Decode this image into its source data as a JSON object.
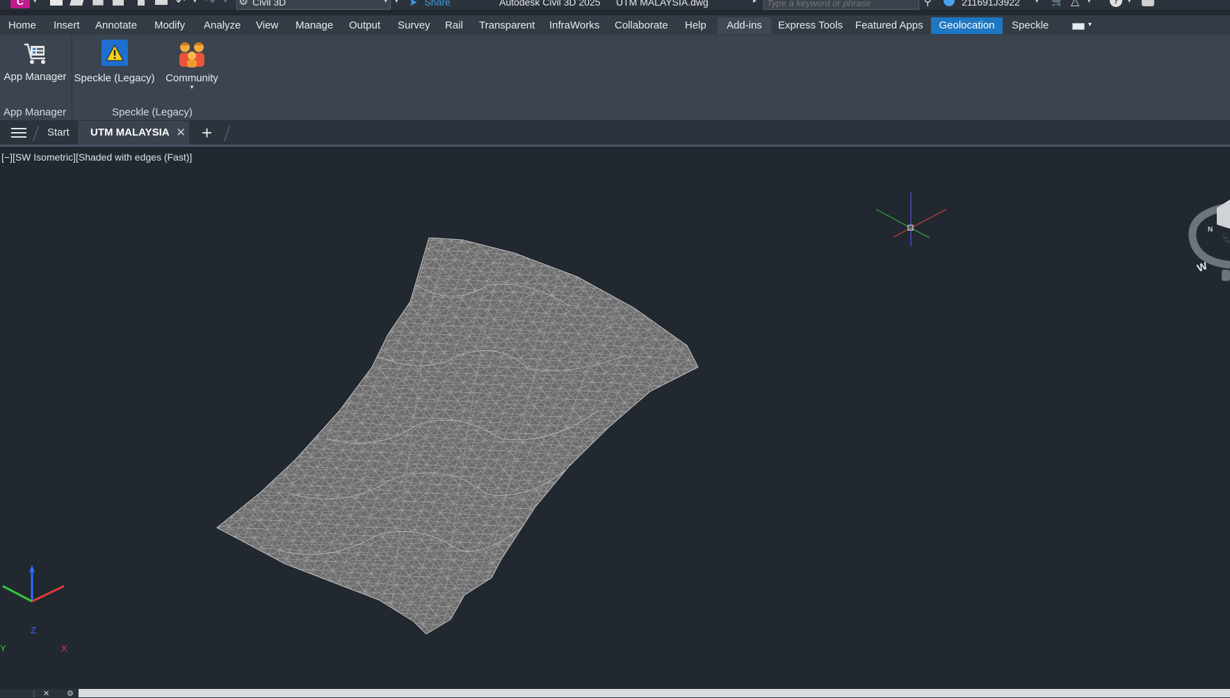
{
  "quick_access": {
    "workspace": "Civil 3D",
    "share_label": "Share"
  },
  "title_bar": {
    "app_title": "Autodesk Civil 3D 2025",
    "file_name": "UTM MALAYSIA.dwg",
    "search_placeholder": "Type a keyword or phrase",
    "user_name": "211691J3922"
  },
  "ribbon": {
    "tabs": [
      "Home",
      "Insert",
      "Annotate",
      "Modify",
      "Analyze",
      "View",
      "Manage",
      "Output",
      "Survey",
      "Rail",
      "Transparent",
      "InfraWorks",
      "Collaborate",
      "Help",
      "Add-ins",
      "Express Tools",
      "Featured Apps",
      "Geolocation",
      "Speckle"
    ],
    "active_tab": "Add-ins",
    "highlight_tab": "Geolocation",
    "buttons": {
      "app_manager": "App Manager",
      "speckle_legacy": "Speckle (Legacy)",
      "community": "Community"
    },
    "groups": {
      "app_manager": "App Manager",
      "speckle_legacy": "Speckle (Legacy)"
    }
  },
  "file_tabs": {
    "start": "Start",
    "active": "UTM MALAYSIA"
  },
  "viewport": {
    "label": "[−][SW Isometric][Shaded with edges (Fast)]",
    "ucs": {
      "x": "X",
      "y": "Y",
      "z": "Z"
    },
    "viewcube": {
      "face": "LEF",
      "north": "N",
      "west": "W"
    }
  },
  "colors": {
    "accent": "#1e77c2",
    "viewport_bg": "#212830",
    "ribbon_bg": "#3c4450",
    "surface": "#6b6b6b"
  }
}
